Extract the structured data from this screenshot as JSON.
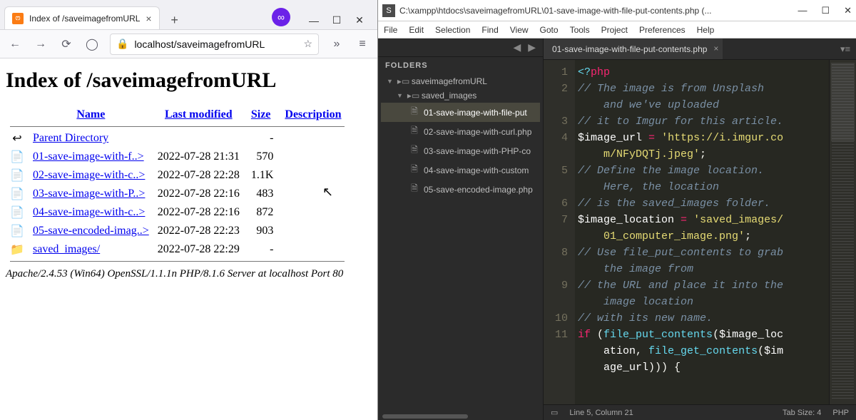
{
  "browser": {
    "tab_title": "Index of /saveimagefromURL",
    "url_display": "localhost/saveimagefromURL",
    "page_heading": "Index of /saveimagefromURL",
    "columns": {
      "name": "Name",
      "modified": "Last modified",
      "size": "Size",
      "desc": "Description"
    },
    "parent_label": "Parent Directory",
    "rows": [
      {
        "name": "01-save-image-with-f..>",
        "modified": "2022-07-28 21:31",
        "size": "570"
      },
      {
        "name": "02-save-image-with-c..>",
        "modified": "2022-07-28 22:28",
        "size": "1.1K"
      },
      {
        "name": "03-save-image-with-P..>",
        "modified": "2022-07-28 22:16",
        "size": "483"
      },
      {
        "name": "04-save-image-with-c..>",
        "modified": "2022-07-28 22:16",
        "size": "872"
      },
      {
        "name": "05-save-encoded-imag..>",
        "modified": "2022-07-28 22:23",
        "size": "903"
      }
    ],
    "dir_row": {
      "name": "saved_images/",
      "modified": "2022-07-28 22:29",
      "size": "-"
    },
    "server_sig": "Apache/2.4.53 (Win64) OpenSSL/1.1.1n PHP/8.1.6 Server at localhost Port 80"
  },
  "editor": {
    "titlebar": "C:\\xampp\\htdocs\\saveimagefromURL\\01-save-image-with-file-put-contents.php (...",
    "menu": [
      "File",
      "Edit",
      "Selection",
      "Find",
      "View",
      "Goto",
      "Tools",
      "Project",
      "Preferences",
      "Help"
    ],
    "sidebar_header": "FOLDERS",
    "tree": {
      "root": "saveimagefromURL",
      "folder": "saved_images",
      "files": [
        "01-save-image-with-file-put",
        "02-save-image-with-curl.php",
        "03-save-image-with-PHP-co",
        "04-save-image-with-custom",
        "05-save-encoded-image.php"
      ]
    },
    "open_tab": "01-save-image-with-file-put-contents.php",
    "status": {
      "pos": "Line 5, Column 21",
      "tab": "Tab Size: 4",
      "lang": "PHP"
    },
    "code_lines": [
      {
        "n": 1,
        "seg": [
          {
            "t": "<?",
            "c": "c-tag"
          },
          {
            "t": "php",
            "c": "c-kw"
          }
        ]
      },
      {
        "n": 2,
        "seg": [
          {
            "t": "// The image is from Unsplash and we've uploaded",
            "c": "c-comment"
          }
        ]
      },
      {
        "n": 3,
        "seg": [
          {
            "t": "// it to Imgur for this article.",
            "c": "c-comment"
          }
        ]
      },
      {
        "n": 4,
        "seg": [
          {
            "t": "$image_url",
            "c": "c-var"
          },
          {
            "t": " ",
            "c": ""
          },
          {
            "t": "=",
            "c": "c-assign"
          },
          {
            "t": " ",
            "c": ""
          },
          {
            "t": "'https://i.imgur.com/NFyDQTj.jpeg'",
            "c": "c-str"
          },
          {
            "t": ";",
            "c": "c-punct"
          }
        ]
      },
      {
        "n": 5,
        "seg": [
          {
            "t": "// Define the image location. Here, the location",
            "c": "c-comment"
          }
        ]
      },
      {
        "n": 6,
        "seg": [
          {
            "t": "// is the saved_images folder.",
            "c": "c-comment"
          }
        ]
      },
      {
        "n": 7,
        "seg": [
          {
            "t": "$image_location",
            "c": "c-var"
          },
          {
            "t": " ",
            "c": ""
          },
          {
            "t": "=",
            "c": "c-assign"
          },
          {
            "t": " ",
            "c": ""
          },
          {
            "t": "'saved_images/01_computer_image.png'",
            "c": "c-str"
          },
          {
            "t": ";",
            "c": "c-punct"
          }
        ]
      },
      {
        "n": 8,
        "seg": [
          {
            "t": "// Use file_put_contents to grab the image from",
            "c": "c-comment"
          }
        ]
      },
      {
        "n": 9,
        "seg": [
          {
            "t": "// the URL and place it into the image location",
            "c": "c-comment"
          }
        ]
      },
      {
        "n": 10,
        "seg": [
          {
            "t": "// with its new name.",
            "c": "c-comment"
          }
        ]
      },
      {
        "n": 11,
        "seg": [
          {
            "t": "if",
            "c": "c-kw"
          },
          {
            "t": " (",
            "c": "c-punct"
          },
          {
            "t": "file_put_contents",
            "c": "c-func"
          },
          {
            "t": "(",
            "c": "c-punct"
          },
          {
            "t": "$image_location",
            "c": "c-var"
          },
          {
            "t": ", ",
            "c": "c-punct"
          },
          {
            "t": "file_get_contents",
            "c": "c-func"
          },
          {
            "t": "(",
            "c": "c-punct"
          },
          {
            "t": "$image_url",
            "c": "c-var"
          },
          {
            "t": "))) {",
            "c": "c-punct"
          }
        ]
      }
    ],
    "continuation_indent": "    "
  }
}
